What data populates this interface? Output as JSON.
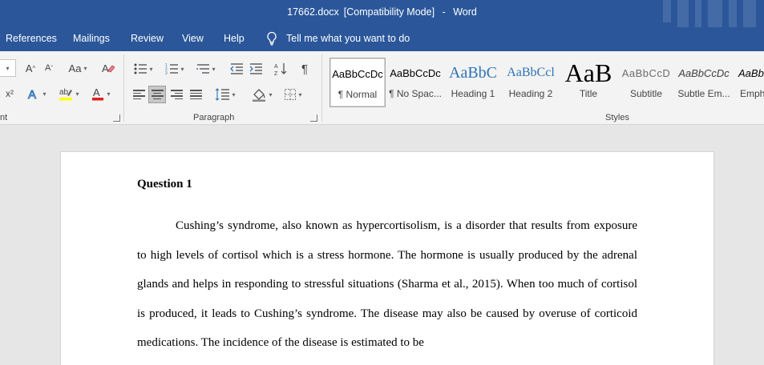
{
  "window": {
    "filename": "17662.docx",
    "mode": "[Compatibility Mode]",
    "separator": "-",
    "app": "Word"
  },
  "tabs": [
    "References",
    "Mailings",
    "Review",
    "View",
    "Help"
  ],
  "tell_me": "Tell me what you want to do",
  "ribbon": {
    "font_group_label": "nt",
    "paragraph_group_label": "Paragraph",
    "styles_group_label": "Styles",
    "font_case_label": "Aa",
    "superscript_label": "x²"
  },
  "styles": [
    {
      "preview": "AaBbCcDc",
      "name": "¶ Normal"
    },
    {
      "preview": "AaBbCcDc",
      "name": "¶ No Spac..."
    },
    {
      "preview": "AaBbC",
      "name": "Heading 1"
    },
    {
      "preview": "AaBbCcl",
      "name": "Heading 2"
    },
    {
      "preview": "AaB",
      "name": "Title"
    },
    {
      "preview": "AaBbCcD",
      "name": "Subtitle"
    },
    {
      "preview": "AaBbCcDc",
      "name": "Subtle Em..."
    },
    {
      "preview": "AaBbCc",
      "name": "Emph"
    }
  ],
  "colors": {
    "title_bar": "#2b579a",
    "ribbon": "#f3f3f3",
    "canvas": "#e6e6e6",
    "font_color_underline": "#e0201b",
    "highlight_underline": "#ffff00",
    "heading_blue": "#2e74b5"
  },
  "document": {
    "heading": "Question 1",
    "paragraph": "Cushing’s syndrome, also known as hypercortisolism, is a disorder that results from exposure to high levels of cortisol which is a stress hormone. The hormone is usually produced by the adrenal glands and helps in responding to stressful situations (Sharma et al., 2015). When too much of cortisol is produced, it leads to Cushing’s syndrome. The disease may also be caused by overuse of corticoid medications. The incidence of the disease is estimated to be"
  }
}
